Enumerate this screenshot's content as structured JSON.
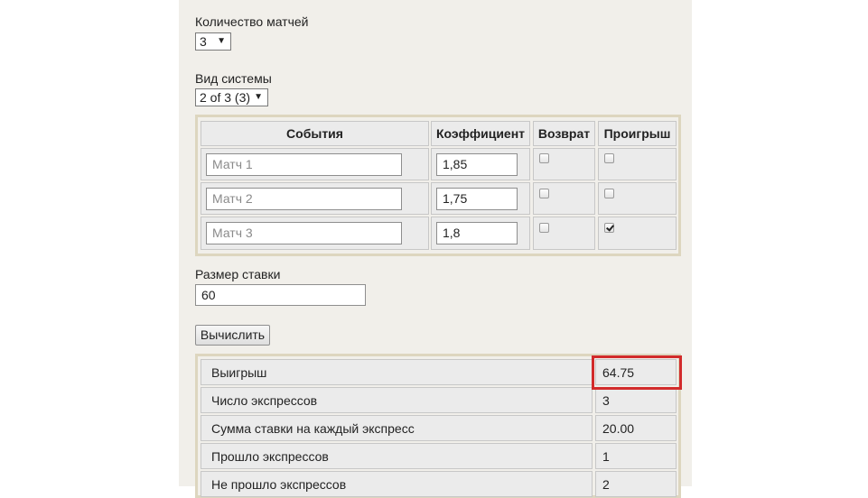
{
  "matches_count": {
    "label": "Количество матчей",
    "value": "3"
  },
  "system_type": {
    "label": "Вид системы",
    "value": "2 of 3 (3)"
  },
  "events_table": {
    "headers": {
      "events": "События",
      "coefficient": "Коэффициент",
      "return": "Возврат",
      "loss": "Проигрыш"
    },
    "rows": [
      {
        "match_placeholder": "Матч 1",
        "coefficient": "1,85",
        "return": false,
        "loss": false
      },
      {
        "match_placeholder": "Матч 2",
        "coefficient": "1,75",
        "return": false,
        "loss": false
      },
      {
        "match_placeholder": "Матч 3",
        "coefficient": "1,8",
        "return": false,
        "loss": true
      }
    ]
  },
  "stake": {
    "label": "Размер ставки",
    "value": "60"
  },
  "calculate_button": "Вычислить",
  "results": [
    {
      "label": "Выигрыш",
      "value": "64.75"
    },
    {
      "label": "Число экспрессов",
      "value": "3"
    },
    {
      "label": "Сумма ставки на каждый экспресс",
      "value": "20.00"
    },
    {
      "label": "Прошло экспрессов",
      "value": "1"
    },
    {
      "label": "Не прошло экспрессов",
      "value": "2"
    }
  ],
  "highlight_color": "#d22b2b"
}
